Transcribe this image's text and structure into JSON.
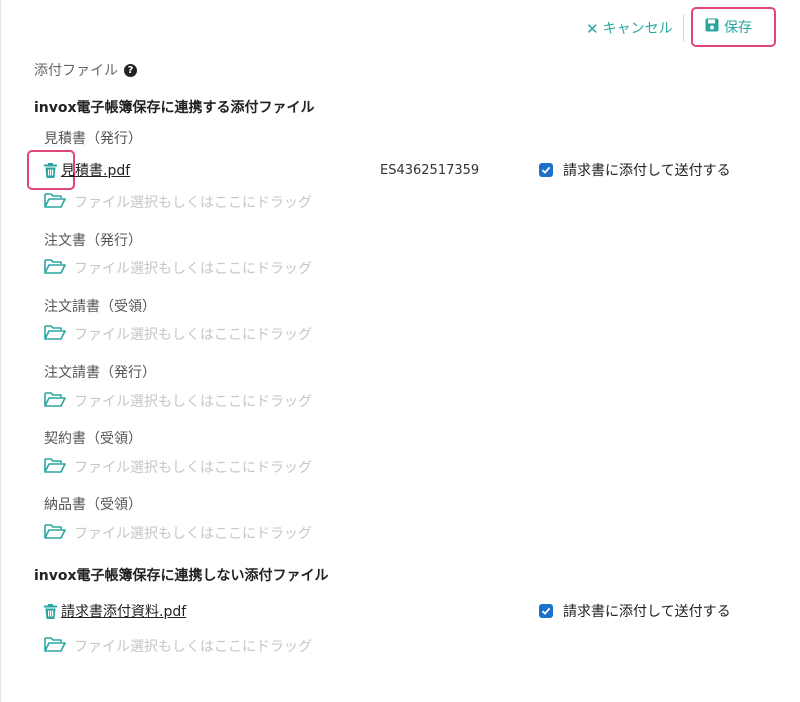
{
  "toolbar": {
    "cancel_label": "キャンセル",
    "save_label": "保存"
  },
  "attachments_label": "添付ファイル",
  "linked_section": {
    "title": "invox電子帳簿保存に連携する添付ファイル",
    "categories": [
      {
        "label": "見積書（発行）",
        "file": {
          "name": "見積書.pdf",
          "doc_id": "ES4362517359",
          "checkbox_label": "請求書に添付して送付する",
          "checked": true
        }
      },
      {
        "label": "注文書（発行）"
      },
      {
        "label": "注文請書（受領）"
      },
      {
        "label": "注文請書（発行）"
      },
      {
        "label": "契約書（受領）"
      },
      {
        "label": "納品書（受領）"
      }
    ]
  },
  "unlinked_section": {
    "title": "invox電子帳簿保存に連携しない添付ファイル",
    "file": {
      "name": "請求書添付資料.pdf",
      "checkbox_label": "請求書に添付して送付する",
      "checked": true
    }
  },
  "dropzone_text": "ファイル選択もしくはここにドラッグ",
  "colors": {
    "accent": "#2aa6a1",
    "highlight": "#e0457b",
    "checkbox": "#1a73c9"
  }
}
